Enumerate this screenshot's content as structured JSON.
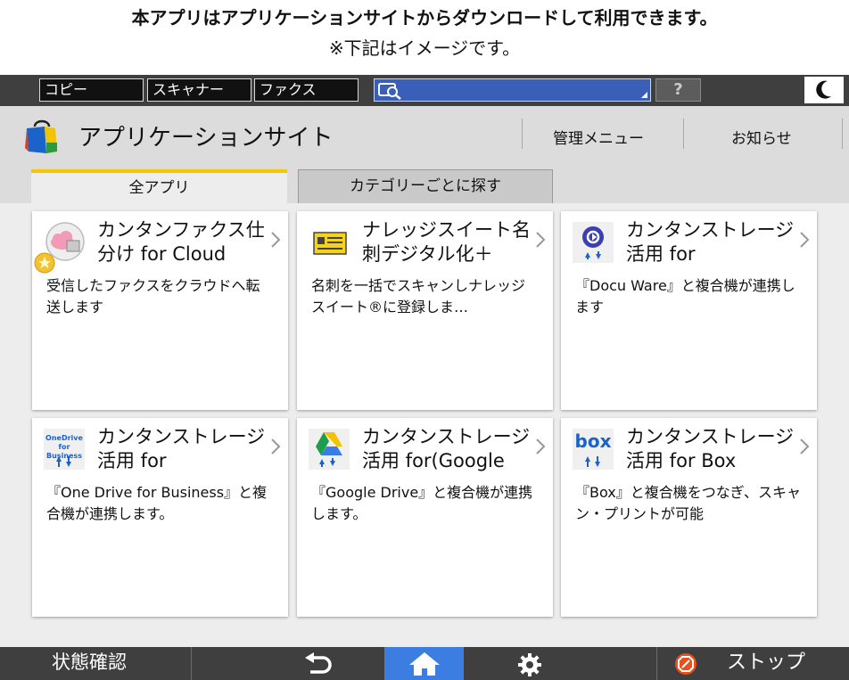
{
  "caption": {
    "main": "本アプリはアプリケーションサイトからダウンロードして利用できます。",
    "sub": "※下記はイメージです。"
  },
  "topbar": {
    "tabs": [
      "コピー",
      "スキャナー",
      "ファクス"
    ],
    "help_label": "?"
  },
  "header": {
    "title": "アプリケーションサイト",
    "admin_menu": "管理メニュー",
    "notice": "お知らせ"
  },
  "tabs": [
    {
      "label": "全アプリ",
      "active": true
    },
    {
      "label": "カテゴリーごとに探す",
      "active": false
    }
  ],
  "cards": [
    {
      "title": "カンタンファクス仕分け for Cloud",
      "description": "受信したファクスをクラウドへ転送します",
      "icon": "fax-cloud-icon"
    },
    {
      "title": "ナレッジスイート名刺デジタル化＋",
      "description": "名刺を一括でスキャンしナレッジスイート®に登録しま…",
      "icon": "business-card-icon"
    },
    {
      "title": "カンタンストレージ活用 for",
      "description": "『Docu Ware』と複合機が連携します",
      "icon": "docuware-icon"
    },
    {
      "title": "カンタンストレージ活用 for",
      "description": "『One Drive for Business』と複合機が連携します。",
      "icon": "onedrive-business-icon",
      "icon_text": [
        "OneDrive",
        "for Business"
      ]
    },
    {
      "title": "カンタンストレージ活用 for(Google",
      "description": "『Google Drive』と複合機が連携します。",
      "icon": "google-drive-icon"
    },
    {
      "title": "カンタンストレージ活用 for Box",
      "description": "『Box』と複合機をつなぎ、スキャン・プリントが可能",
      "icon": "box-icon",
      "icon_text": [
        "box"
      ]
    }
  ],
  "bottombar": {
    "status_label": "状態確認",
    "stop_label": "ストップ"
  },
  "colors": {
    "topbar_bg": "#3f3f3f",
    "tab_accent": "#f6c700",
    "home_active": "#3b7de0",
    "input_blue": "#3a5fb8",
    "stop_orange": "#e8501e"
  }
}
